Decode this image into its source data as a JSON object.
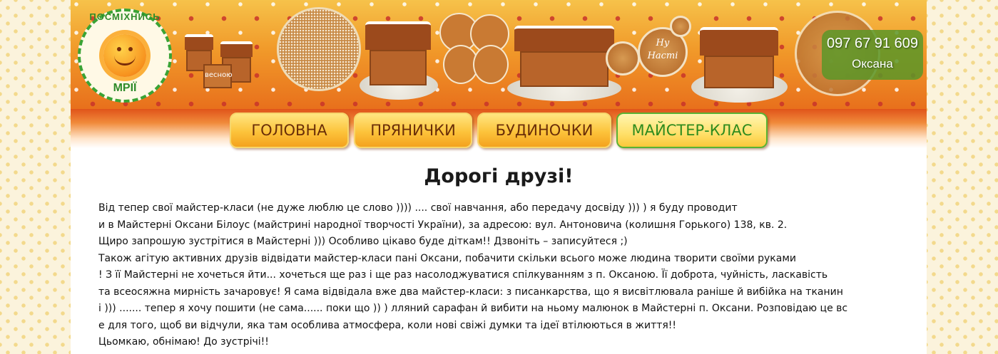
{
  "logo": {
    "top_text": "ПОСМІХНИСЬ",
    "bottom_text": "МРІЇ"
  },
  "contact": {
    "phone": "097 67 91 609",
    "name": "Оксана"
  },
  "nav": {
    "items": [
      {
        "label": "ГОЛОВНА",
        "active": false
      },
      {
        "label": "ПРЯНИЧКИ",
        "active": false
      },
      {
        "label": "БУДИНОЧКИ",
        "active": false
      },
      {
        "label": "МАЙСТЕР-КЛАС",
        "active": true
      }
    ]
  },
  "banner": {
    "cookie_text_1": "Ну",
    "cookie_text_2": "Насті",
    "house_sign": "весною"
  },
  "content": {
    "heading": "Дорогі друзі!",
    "lines": [
      "Від тепер свої майстер-класи (не дуже люблю це слово )))) .... свої навчання, або передачу досвіду ))) ) я буду проводит",
      "и в Майстерні Оксани Білоус (майстрині народної творчості України), за адресою: вул. Антоновича (колишня Горького) 138, кв. 2.",
      "Щиро запрошую зустрітися в Майстерні ))) Особливо цікаво буде діткам!! Дзвоніть – записуйтеся ;)",
      "Також агітую активних друзів відвідати майстер-класи пані Оксани, побачити скільки всього може людина творити своїми руками",
      "! З її Майстерні не хочеться йти... хочеться ще раз і ще раз насолоджуватися спілкуванням з п. Оксаною. Її доброта, чуйність, ласкавість",
      "та всеосяжна мирність зачаровує! Я сама відвідала вже два майстер-класи: з писанкарства, що я висвітлювала раніше й вибійка на тканин",
      "і ))) ....... тепер я хочу пошити (не сама...... поки що )) ) лляний сарафан й вибити на ньому малюнок в Майстерні п. Оксани. Розповідаю це вс",
      "е для того, щоб ви відчули, яка там особлива атмосфера, коли нові свіжі думки та ідеї втілюються в життя!!",
      "Цьомкаю, обнімаю! До зустрічі!!"
    ]
  },
  "colors": {
    "banner_orange": "#f19a2a",
    "nav_active_text": "#2e8b1e",
    "nav_text": "#6a2e08",
    "logo_green": "#2e8b2a"
  }
}
